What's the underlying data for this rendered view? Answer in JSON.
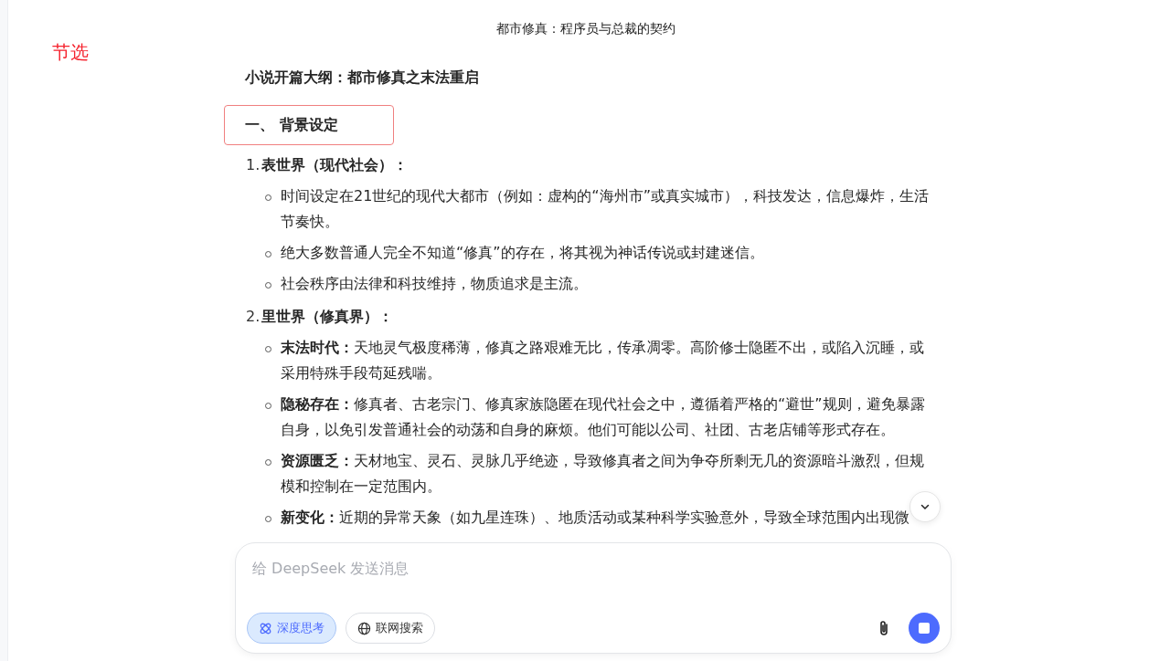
{
  "conversation_title": "都市修真：程序员与总裁的契约",
  "excerpt_label": "节选",
  "outline_title": "小说开篇大纲：都市修真之末法重启",
  "section": {
    "heading": "一、 背景设定",
    "highlighted": true
  },
  "items": [
    {
      "number": "1.",
      "title": "表世界（现代社会）：",
      "bullets": [
        {
          "text": "时间设定在21世纪的现代大都市（例如：虚构的“海州市”或真实城市），科技发达，信息爆炸，生活节奏快。"
        },
        {
          "text": "绝大多数普通人完全不知道“修真”的存在，将其视为神话传说或封建迷信。"
        },
        {
          "text": "社会秩序由法律和科技维持，物质追求是主流。"
        }
      ]
    },
    {
      "number": "2.",
      "title": "里世界（修真界）：",
      "bullets": [
        {
          "term": "末法时代：",
          "text": "天地灵气极度稀薄，修真之路艰难无比，传承凋零。高阶修士隐匿不出，或陷入沉睡，或采用特殊手段苟延残喘。"
        },
        {
          "term": "隐秘存在：",
          "text": "修真者、古老宗门、修真家族隐匿在现代社会之中，遵循着严格的“避世”规则，避免暴露自身，以免引发普通社会的动荡和自身的麻烦。他们可能以公司、社团、古老店铺等形式存在。"
        },
        {
          "term": "资源匮乏：",
          "text": "天材地宝、灵石、灵脉几乎绝迹，导致修真者之间为争夺所剩无几的资源暗斗激烈，但规模和控制在一定范围内。"
        },
        {
          "term": "新变化：",
          "text": "近期的异常天象（如九星连珠）、地质活动或某种科学实验意外，导致全球范围内出现微"
        }
      ]
    }
  ],
  "composer": {
    "placeholder": "给 DeepSeek 发送消息",
    "toggles": [
      {
        "label": "深度思考",
        "kind": "think",
        "selected": true
      },
      {
        "label": "联网搜索",
        "kind": "web",
        "selected": false
      }
    ]
  }
}
